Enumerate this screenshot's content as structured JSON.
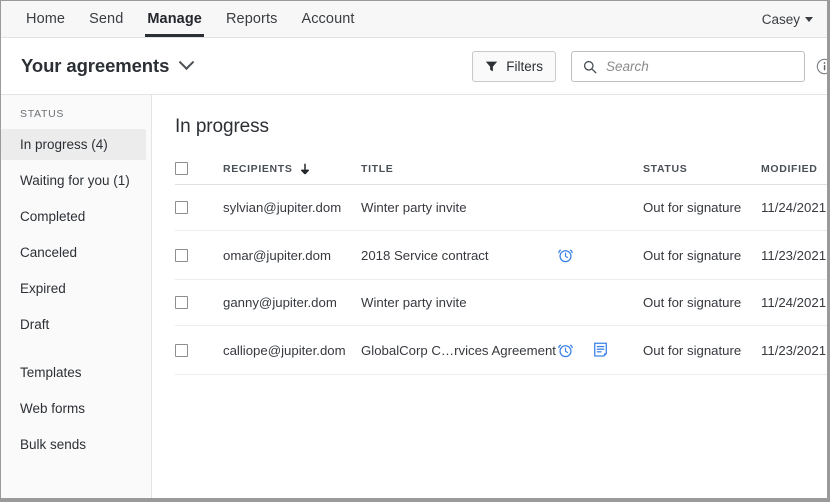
{
  "topnav": {
    "items": [
      {
        "label": "Home",
        "active": false
      },
      {
        "label": "Send",
        "active": false
      },
      {
        "label": "Manage",
        "active": true
      },
      {
        "label": "Reports",
        "active": false
      },
      {
        "label": "Account",
        "active": false
      }
    ],
    "user": "Casey"
  },
  "subheader": {
    "title": "Your agreements",
    "filters_label": "Filters",
    "search_placeholder": "Search",
    "search_value": ""
  },
  "sidebar": {
    "section_label": "STATUS",
    "status_items": [
      {
        "label": "In progress (4)",
        "selected": true
      },
      {
        "label": "Waiting for you (1)",
        "selected": false
      },
      {
        "label": "Completed",
        "selected": false
      },
      {
        "label": "Canceled",
        "selected": false
      },
      {
        "label": "Expired",
        "selected": false
      },
      {
        "label": "Draft",
        "selected": false
      }
    ],
    "other_items": [
      {
        "label": "Templates",
        "selected": false
      },
      {
        "label": "Web forms",
        "selected": false
      },
      {
        "label": "Bulk sends",
        "selected": false
      }
    ]
  },
  "main": {
    "section_title": "In progress",
    "columns": {
      "recipients": "RECIPIENTS",
      "title": "TITLE",
      "status": "STATUS",
      "modified": "MODIFIED"
    },
    "sort": {
      "column": "RECIPIENTS",
      "direction": "down"
    },
    "rows": [
      {
        "recipient": "sylvian@jupiter.dom",
        "title": "Winter party invite",
        "reminder": false,
        "form": false,
        "status": "Out for signature",
        "modified": "11/24/2021"
      },
      {
        "recipient": "omar@jupiter.dom",
        "title": "2018 Service contract",
        "reminder": true,
        "form": false,
        "status": "Out for signature",
        "modified": "11/23/2021"
      },
      {
        "recipient": "ganny@jupiter.dom",
        "title": "Winter party invite",
        "reminder": false,
        "form": false,
        "status": "Out for signature",
        "modified": "11/24/2021"
      },
      {
        "recipient": "calliope@jupiter.dom",
        "title": "GlobalCorp C…rvices Agreement",
        "reminder": true,
        "form": true,
        "status": "Out for signature",
        "modified": "11/23/2021"
      }
    ]
  },
  "colors": {
    "icon_blue": "#3b82e8",
    "selected_bg": "#ececec",
    "active_underline": "#2b2f34",
    "text": "#2c3035"
  }
}
